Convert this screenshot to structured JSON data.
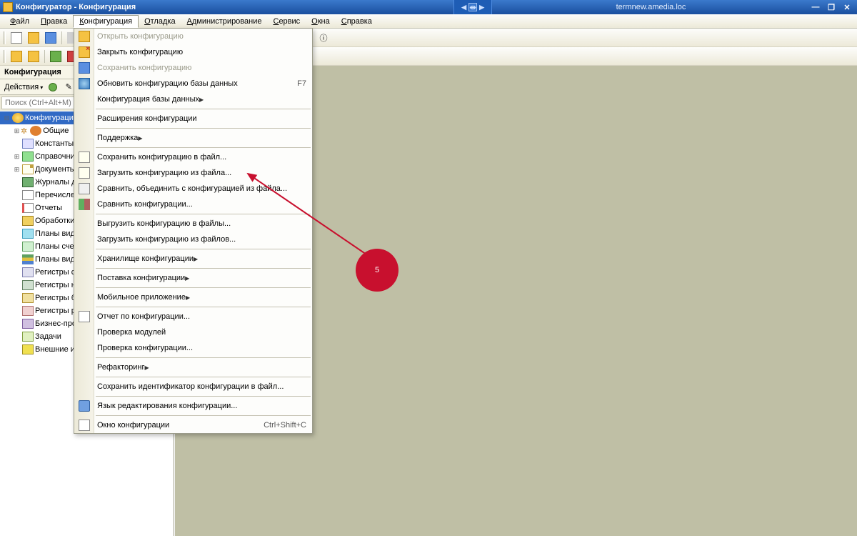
{
  "title": "Конфигуратор - Конфигурация",
  "remote_host": "termnew.amedia.loc",
  "menubar": [
    "Файл",
    "Правка",
    "Конфигурация",
    "Отладка",
    "Администрирование",
    "Сервис",
    "Окна",
    "Справка"
  ],
  "menubar_open_index": 2,
  "panel": {
    "title": "Конфигурация",
    "actions_label": "Действия",
    "search_placeholder": "Поиск (Ctrl+Alt+M)"
  },
  "tree": [
    {
      "label": "Конфигурация",
      "icon": "nic-root",
      "exp": "-",
      "sel": true,
      "indent": 0
    },
    {
      "label": "Общие",
      "icon": "nic-cog",
      "exp": "+",
      "indent": 1,
      "extra": true
    },
    {
      "label": "Константы",
      "icon": "nic-table",
      "exp": "none",
      "indent": 1
    },
    {
      "label": "Справочник",
      "icon": "nic-book",
      "exp": "+",
      "indent": 1
    },
    {
      "label": "Документы",
      "icon": "nic-doc",
      "exp": "+",
      "indent": 1
    },
    {
      "label": "Журналы до",
      "icon": "nic-journal",
      "exp": "none",
      "indent": 1
    },
    {
      "label": "Перечислен",
      "icon": "nic-enum",
      "exp": "none",
      "indent": 1
    },
    {
      "label": "Отчеты",
      "icon": "nic-report",
      "exp": "none",
      "indent": 1
    },
    {
      "label": "Обработки",
      "icon": "nic-proc",
      "exp": "none",
      "indent": 1
    },
    {
      "label": "Планы видо",
      "icon": "nic-chart",
      "exp": "none",
      "indent": 1
    },
    {
      "label": "Планы счет",
      "icon": "nic-acc",
      "exp": "none",
      "indent": 1
    },
    {
      "label": "Планы видо",
      "icon": "nic-layers",
      "exp": "none",
      "indent": 1
    },
    {
      "label": "Регистры с",
      "icon": "nic-reg",
      "exp": "none",
      "indent": 1
    },
    {
      "label": "Регистры н",
      "icon": "nic-regacc",
      "exp": "none",
      "indent": 1
    },
    {
      "label": "Регистры б",
      "icon": "nic-regbal",
      "exp": "none",
      "indent": 1
    },
    {
      "label": "Регистры р",
      "icon": "nic-regcalc",
      "exp": "none",
      "indent": 1
    },
    {
      "label": "Бизнес-про",
      "icon": "nic-bp",
      "exp": "none",
      "indent": 1
    },
    {
      "label": "Задачи",
      "icon": "nic-task",
      "exp": "none",
      "indent": 1
    },
    {
      "label": "Внешние ис",
      "icon": "nic-ext",
      "exp": "none",
      "indent": 1
    }
  ],
  "dropdown": [
    {
      "label": "Открыть конфигурацию",
      "icon": "mic-open",
      "disabled": true
    },
    {
      "label": "Закрыть конфигурацию",
      "icon": "mic-close"
    },
    {
      "label": "Сохранить конфигурацию",
      "icon": "mic-save",
      "disabled": true
    },
    {
      "label": "Обновить конфигурацию базы данных",
      "icon": "mic-db",
      "shortcut": "F7"
    },
    {
      "label": "Конфигурация базы данных",
      "sub": true
    },
    {
      "sep": true
    },
    {
      "label": "Расширения конфигурации"
    },
    {
      "sep": true
    },
    {
      "label": "Поддержка",
      "sub": true
    },
    {
      "sep": true
    },
    {
      "label": "Сохранить конфигурацию в файл...",
      "icon": "mic-savefile"
    },
    {
      "label": "Загрузить конфигурацию из файла...",
      "icon": "mic-loadfile"
    },
    {
      "label": "Сравнить, объединить с конфигурацией из файла...",
      "icon": "mic-cmp"
    },
    {
      "label": "Сравнить конфигурации...",
      "icon": "mic-cmp2"
    },
    {
      "sep": true
    },
    {
      "label": "Выгрузить конфигурацию в файлы..."
    },
    {
      "label": "Загрузить конфигурацию из файлов..."
    },
    {
      "sep": true
    },
    {
      "label": "Хранилище конфигурации",
      "sub": true
    },
    {
      "sep": true
    },
    {
      "label": "Поставка конфигурации",
      "sub": true
    },
    {
      "sep": true
    },
    {
      "label": "Мобильное приложение",
      "sub": true
    },
    {
      "sep": true
    },
    {
      "label": "Отчет по конфигурации...",
      "icon": "mic-report"
    },
    {
      "label": "Проверка модулей"
    },
    {
      "label": "Проверка конфигурации..."
    },
    {
      "sep": true
    },
    {
      "label": "Рефакторинг",
      "sub": true
    },
    {
      "sep": true
    },
    {
      "label": "Сохранить идентификатор конфигурации в файл..."
    },
    {
      "sep": true
    },
    {
      "label": "Язык редактирования конфигурации...",
      "icon": "mic-lang"
    },
    {
      "sep": true
    },
    {
      "label": "Окно конфигурации",
      "icon": "mic-win",
      "shortcut": "Ctrl+Shift+C"
    }
  ],
  "annotation": {
    "number": "5"
  }
}
